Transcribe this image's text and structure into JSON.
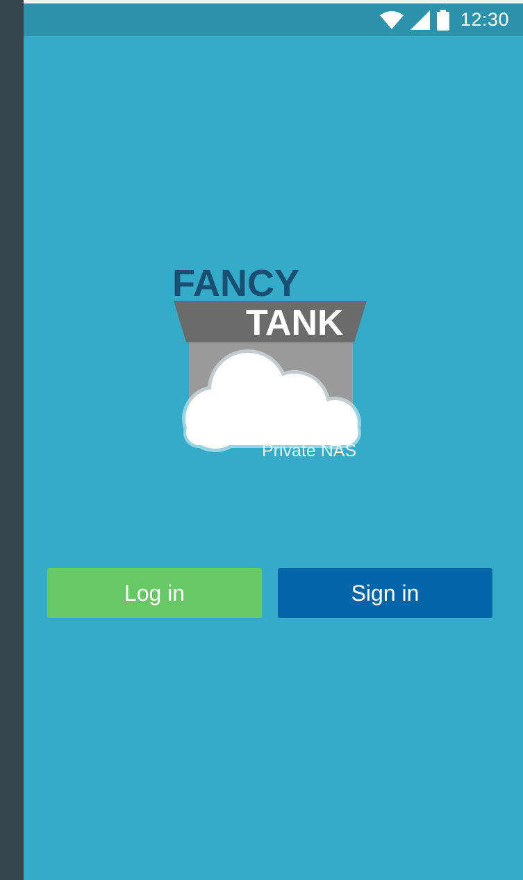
{
  "status_bar": {
    "time": "12:30",
    "icons": [
      "wifi-icon",
      "signal-icon",
      "battery-icon"
    ]
  },
  "logo": {
    "line1": "FANCY",
    "line2": "TANK",
    "tagline": "Private NAS"
  },
  "actions": {
    "login_label": "Log in",
    "signin_label": "Sign in"
  },
  "colors": {
    "background": "#33abc9",
    "status_bar": "#2d93ad",
    "login_button": "#66c966",
    "signin_button": "#0466a8",
    "logo_dark_text": "#1a4e73"
  }
}
